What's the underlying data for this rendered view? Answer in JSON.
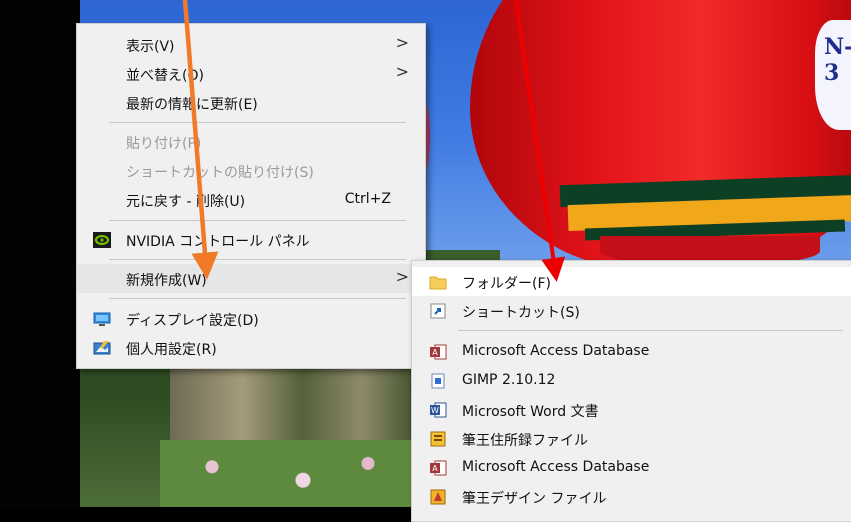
{
  "context_menu": {
    "items": [
      {
        "label": "表示(V)",
        "has_submenu": true
      },
      {
        "label": "並べ替え(O)",
        "has_submenu": true
      },
      {
        "label": "最新の情報に更新(E)"
      },
      {
        "label": "貼り付け(P)",
        "disabled": true
      },
      {
        "label": "ショートカットの貼り付け(S)",
        "disabled": true
      },
      {
        "label": "元に戻す - 削除(U)",
        "shortcut": "Ctrl+Z"
      },
      {
        "label": "NVIDIA コントロール パネル",
        "icon": "nvidia-icon"
      },
      {
        "label": "新規作成(W)",
        "has_submenu": true,
        "highlighted": true
      },
      {
        "label": "ディスプレイ設定(D)",
        "icon": "display-settings-icon"
      },
      {
        "label": "個人用設定(R)",
        "icon": "personalize-icon"
      }
    ],
    "submenu_arrow": ">"
  },
  "new_submenu": {
    "items": [
      {
        "label": "フォルダー(F)",
        "icon": "folder-icon",
        "highlighted": true
      },
      {
        "label": "ショートカット(S)",
        "icon": "shortcut-icon"
      },
      {
        "label": "Microsoft Access Database",
        "icon": "access-icon"
      },
      {
        "label": "GIMP 2.10.12",
        "icon": "gimp-file-icon"
      },
      {
        "label": "Microsoft Word 文書",
        "icon": "word-icon"
      },
      {
        "label": "筆王住所録ファイル",
        "icon": "address-book-icon"
      },
      {
        "label": "Microsoft Access Database",
        "icon": "access-icon"
      },
      {
        "label": "筆王デザイン ファイル",
        "icon": "design-file-icon"
      }
    ]
  },
  "wallpaper": {
    "balloon_text": "N-3"
  },
  "colors": {
    "menu_bg": "#f0f0f0",
    "highlight": "#e6e6e6",
    "annotation_orange": "#f07a26",
    "annotation_red": "#ee0000"
  }
}
